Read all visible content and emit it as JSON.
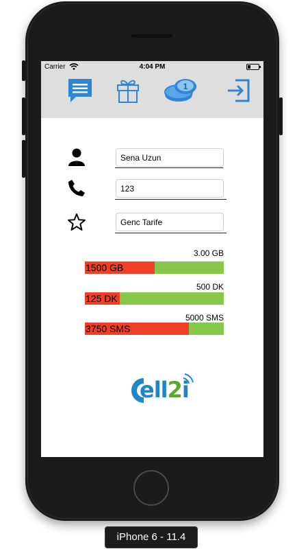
{
  "status_bar": {
    "carrier": "Carrier",
    "time": "4:04 PM",
    "wifi_icon": "wifi-icon",
    "battery_icon": "battery-icon"
  },
  "tabs": [
    {
      "icon": "chat-icon",
      "color": "#2f86d6"
    },
    {
      "icon": "gift-icon",
      "color": "#2f86d6"
    },
    {
      "icon": "coins-icon",
      "color": "#2f86d6",
      "coin_text": "1"
    },
    {
      "icon": "logout-icon",
      "color": "#2f86d6"
    }
  ],
  "profile": {
    "name": "Sena Uzun",
    "phone": "123",
    "tariff": "Genc Tarife",
    "name_icon": "person-icon",
    "phone_icon": "phone-icon",
    "tariff_icon": "star-icon"
  },
  "usage": [
    {
      "total": "3.00 GB",
      "used": "1500 GB",
      "fraction": 0.5
    },
    {
      "total": "500 DK",
      "used": "125 DK",
      "fraction": 0.25
    },
    {
      "total": "5000 SMS",
      "used": "3750 SMS",
      "fraction": 0.75
    }
  ],
  "colors": {
    "used": "#ee4027",
    "remaining": "#87c84a",
    "accent": "#2f86d6"
  },
  "logo": {
    "name": "Cell2i logo",
    "text": "Cell2i"
  },
  "device_label": "iPhone 6 - 11.4"
}
